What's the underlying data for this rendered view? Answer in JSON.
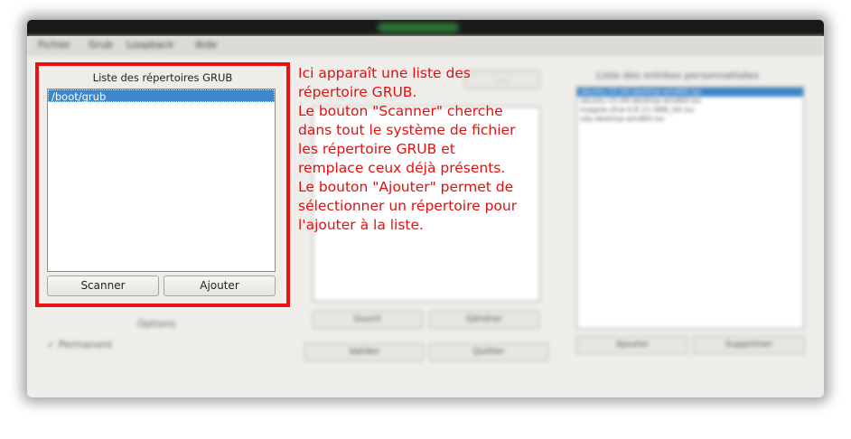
{
  "menu": [
    "Fichier",
    "Grub",
    "Loopback",
    "Aide"
  ],
  "left_panel": {
    "title": "Liste des répertoires GRUB",
    "items": [
      "/boot/grub"
    ],
    "buttons": {
      "scan": "Scanner",
      "add": "Ajouter"
    },
    "options_label": "Options",
    "permanent_label": "Permanent"
  },
  "middle_panel": {
    "top_button": "...",
    "open_button": "Ouvrir",
    "generate_button": "Générer",
    "validate_button": "Valider",
    "quit_button": "Quitter"
  },
  "right_panel": {
    "title": "Liste des entrées personnalisées",
    "items": [
      "ubuntu-15.04-desktop-amd64.iso",
      "ubuntu-15.04-desktop-amd64.iso",
      "mageia-xfce-4.8.11-i486_64.iso",
      "sdy-desktop-amd64.iso"
    ],
    "add_button": "Ajouter",
    "remove_button": "Supprimer"
  },
  "annotation": {
    "lines": [
      "Ici apparaît une liste des",
      "répertoire GRUB.",
      "Le bouton \"Scanner\" cherche",
      "dans tout le système de fichier",
      "les répertoire GRUB et",
      "remplace ceux déjà présents.",
      "Le bouton \"Ajouter\" permet de",
      "sélectionner un répertoire pour",
      "l'ajouter à la liste."
    ],
    "color": "#e01010"
  },
  "colors": {
    "highlight_border": "#ee1111",
    "selection": "#3c87cd"
  }
}
